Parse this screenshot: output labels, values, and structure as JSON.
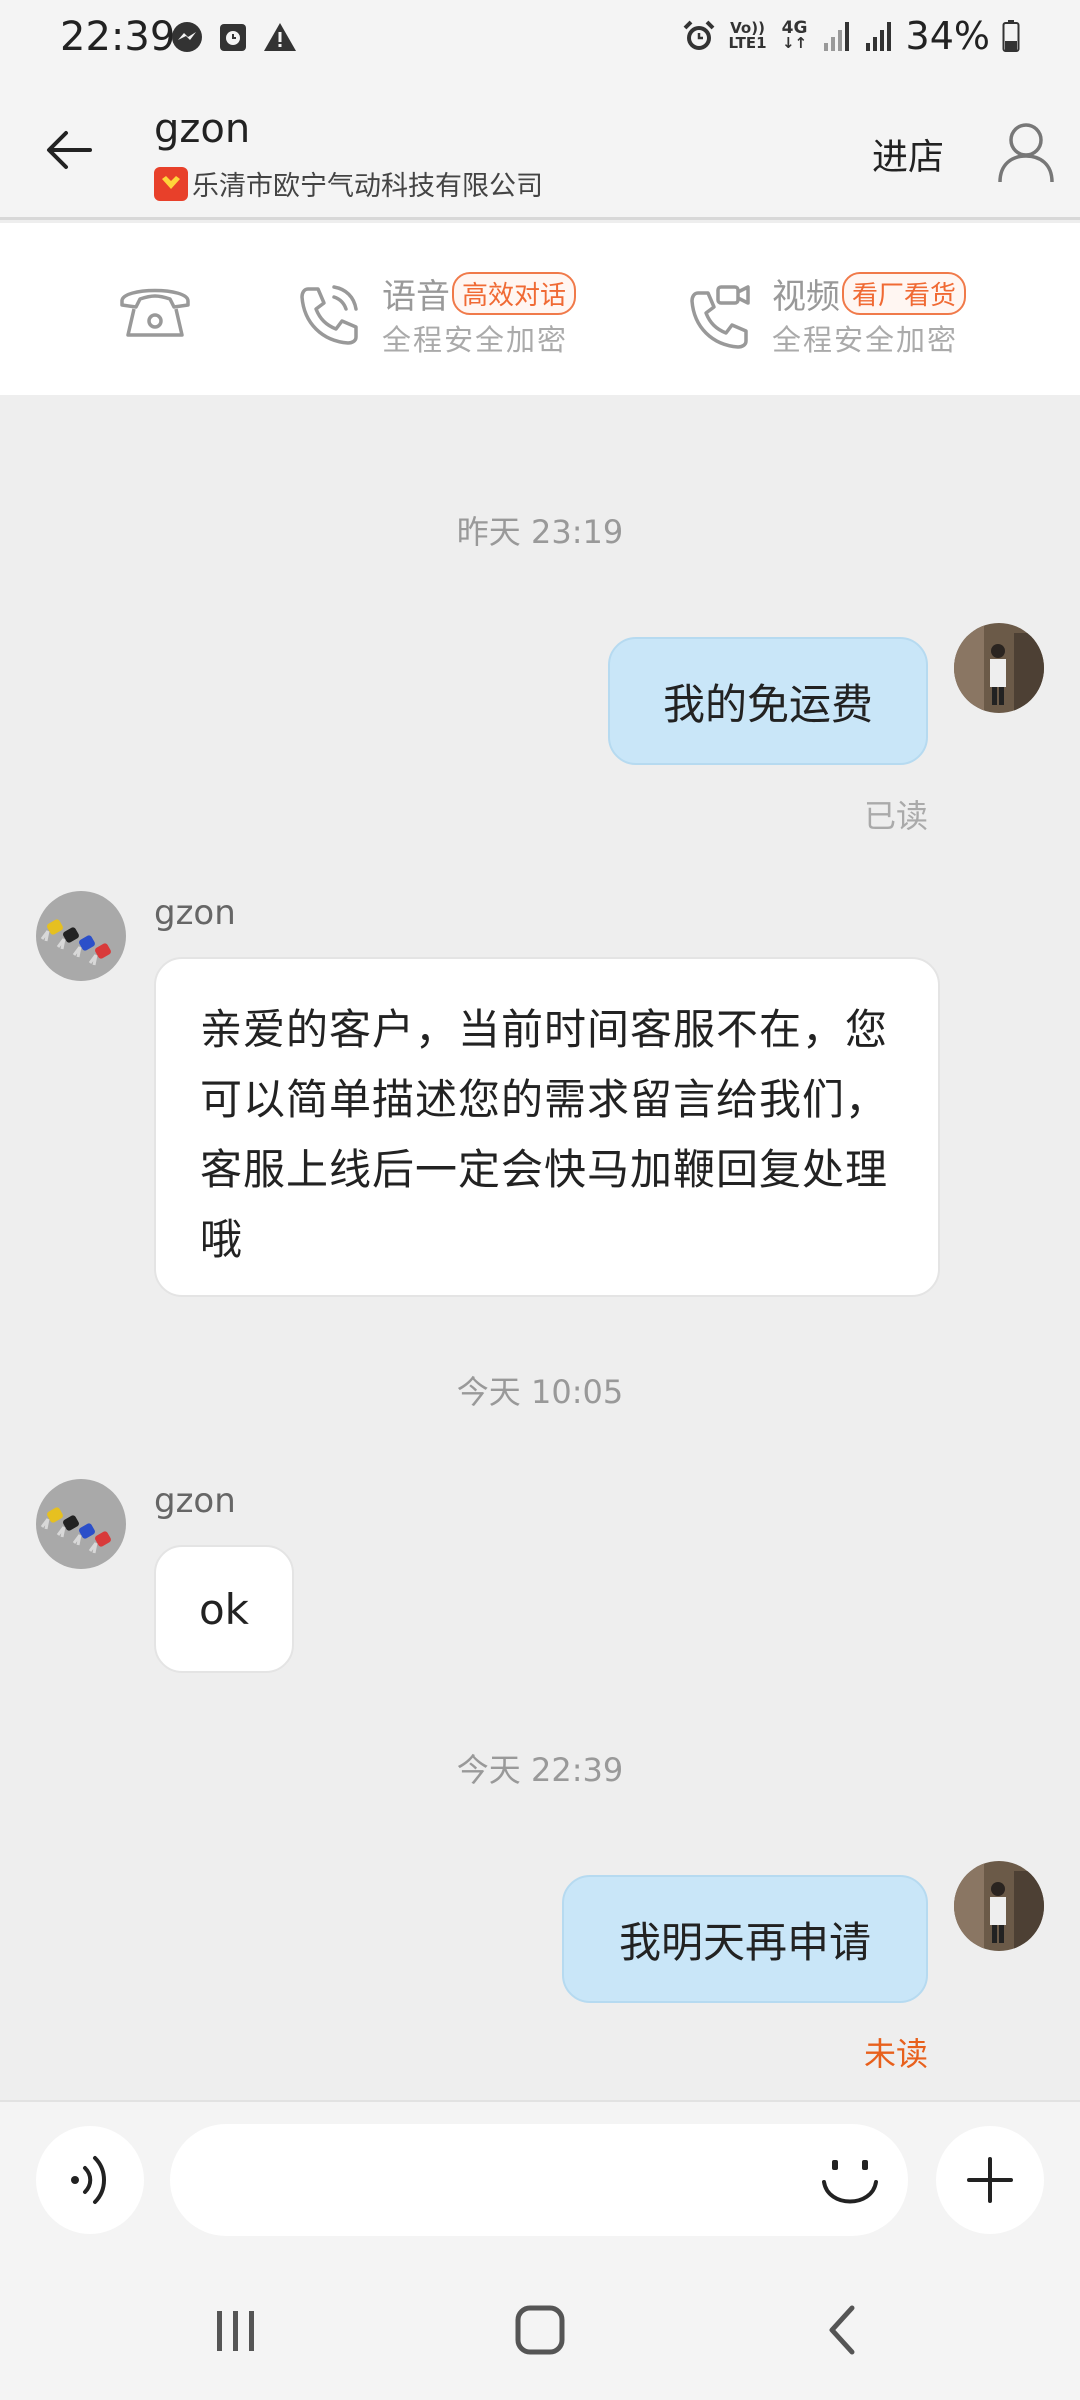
{
  "status_bar": {
    "time": "22:39",
    "left_icons": [
      "messenger-icon",
      "clock-app-icon",
      "warning-icon"
    ],
    "right_icons": [
      "alarm-icon",
      "volte-icon",
      "4g-icon",
      "signal-icon",
      "signal-icon"
    ],
    "volte_text": "Vo)) LTE1",
    "net_text": "4G",
    "battery": "34%"
  },
  "header": {
    "title": "gzon",
    "company": "乐清市欧宁气动科技有限公司",
    "enter_store": "进店"
  },
  "call_bar": {
    "voice": {
      "label": "语音",
      "tag": "高效对话",
      "sub": "全程安全加密"
    },
    "video": {
      "label": "视频",
      "tag": "看厂看货",
      "sub": "全程安全加密"
    }
  },
  "messages": {
    "ts1": "昨天  23:19",
    "out1": {
      "text": "我的免运费",
      "status": "已读"
    },
    "in1": {
      "sender": "gzon",
      "text": "亲爱的客户，当前时间客服不在，您可以简单描述您的需求留言给我们，客服上线后一定会快马加鞭回复处理哦"
    },
    "ts2": "今天  10:05",
    "in2": {
      "sender": "gzon",
      "text": "ok"
    },
    "ts3": "今天  22:39",
    "out2": {
      "text": "我明天再申请",
      "status": "未读"
    }
  },
  "input": {
    "value": "",
    "placeholder": ""
  },
  "colors": {
    "outgoing_bubble": "#c9e6f8",
    "incoming_bubble": "#ffffff",
    "read_color": "#aaaaaa",
    "unread_color": "#e8601c",
    "tag_color": "#f06a34"
  }
}
